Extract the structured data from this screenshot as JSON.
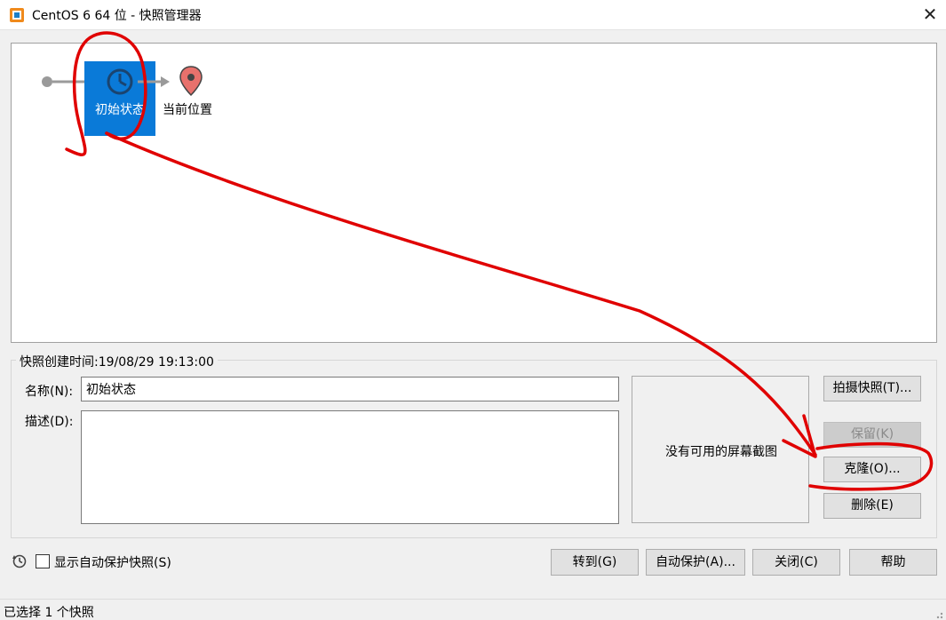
{
  "window": {
    "title": "CentOS 6 64 位 - 快照管理器"
  },
  "tree": {
    "snapshot_label": "初始状态",
    "current_label": "当前位置"
  },
  "details": {
    "created_label": "快照创建时间:19/08/29 19:13:00",
    "name_label": "名称(N):",
    "name_value": "初始状态",
    "desc_label": "描述(D):",
    "desc_value": "",
    "screenshot_placeholder": "没有可用的屏幕截图"
  },
  "side_buttons": {
    "take": "拍摄快照(T)...",
    "keep": "保留(K)",
    "clone": "克隆(O)...",
    "delete": "删除(E)"
  },
  "bottom": {
    "show_auto_label": "显示自动保护快照(S)",
    "goto": "转到(G)",
    "auto_protect": "自动保护(A)...",
    "close": "关闭(C)",
    "help": "帮助"
  },
  "status": {
    "text": "已选择 1 个快照"
  },
  "colors": {
    "selection": "#0a7ad8",
    "pin": "#e8716c",
    "annotation": "#e00000"
  }
}
